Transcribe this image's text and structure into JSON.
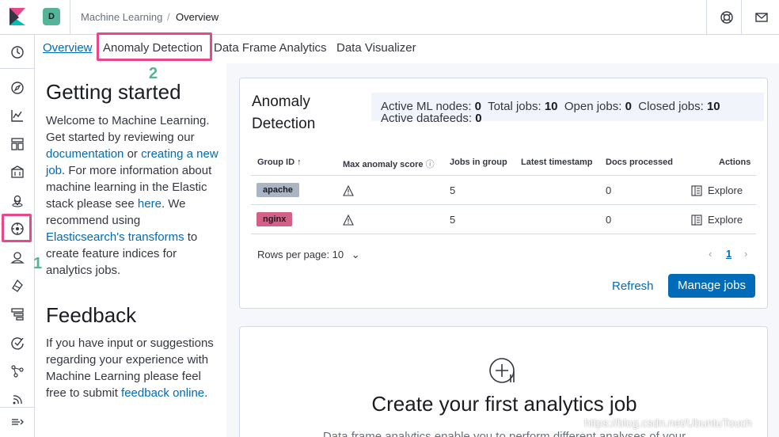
{
  "header": {
    "avatar_initial": "D",
    "breadcrumbs": [
      "Machine Learning",
      "Overview"
    ],
    "breadcrumb_separator": "/",
    "icons": [
      "kibana-logo",
      "help-icon",
      "mail-icon"
    ]
  },
  "sidenav": {
    "icons": [
      "recent-icon",
      "discover-icon",
      "visualize-icon",
      "dashboard-icon",
      "canvas-icon",
      "maps-icon",
      "machine-learning-icon",
      "infrastructure-icon",
      "logs-icon",
      "apm-icon",
      "uptime-icon",
      "graph-icon",
      "dev-tools-icon",
      "collapse-icon"
    ],
    "annotation_number": "1"
  },
  "tabs": {
    "items": [
      "Overview",
      "Anomaly Detection",
      "Data Frame Analytics",
      "Data Visualizer"
    ],
    "active": "Overview",
    "annotation_number": "2"
  },
  "left": {
    "getting_started_title": "Getting started",
    "welcome_text_1": "Welcome to Machine Learning. Get started by reviewing our",
    "documentation_link": "documentation",
    "or_text": "or",
    "creating_job_link": "creating a new job",
    "welcome_text_2": ". For more information about machine learning in the Elastic stack please see",
    "here_link": "here",
    "recommend_text": ". We recommend using",
    "transforms_link": "Elasticsearch's transforms",
    "recommend_text_2": "to create feature indices for analytics jobs.",
    "feedback_title": "Feedback",
    "feedback_text": "If you have input or suggestions regarding your experience with Machine Learning please feel free to submit",
    "feedback_link": "feedback online",
    "feedback_end": "."
  },
  "anomaly_panel": {
    "title": "Anomaly Detection",
    "stats": {
      "active_ml_nodes_label": "Active ML nodes:",
      "active_ml_nodes": "0",
      "total_jobs_label": "Total jobs:",
      "total_jobs": "10",
      "open_jobs_label": "Open jobs:",
      "open_jobs": "0",
      "closed_jobs_label": "Closed jobs:",
      "closed_jobs": "10",
      "active_datafeeds_label": "Active datafeeds:",
      "active_datafeeds": "0"
    },
    "columns": [
      "Group ID",
      "Max anomaly score",
      "Jobs in group",
      "Latest timestamp",
      "Docs processed",
      "Actions"
    ],
    "rows": [
      {
        "group": "apache",
        "badge_color": "#aab4c3",
        "jobs": "5",
        "latest": "",
        "docs": "0",
        "action": "Explore"
      },
      {
        "group": "nginx",
        "badge_color": "#d36086",
        "jobs": "5",
        "latest": "",
        "docs": "0",
        "action": "Explore"
      }
    ],
    "rows_per_page": "Rows per page: 10",
    "current_page": "1",
    "refresh_label": "Refresh",
    "manage_label": "Manage jobs"
  },
  "analytics_panel": {
    "title": "Create your first analytics job",
    "description": "Data frame analytics enable you to perform different analyses of your"
  },
  "watermark": "https://blog.csdn.net/UbuntuTouch",
  "colors": {
    "accent": "#006bb8",
    "highlight": "#e8488b",
    "annotation": "#54b399"
  }
}
